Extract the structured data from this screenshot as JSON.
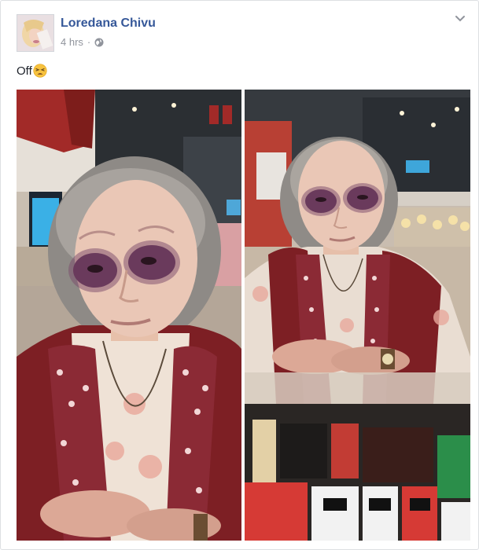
{
  "post": {
    "author": "Loredana Chivu",
    "timestamp": "4 hrs",
    "audience_icon": "globe-icon",
    "menu_icon": "chevron-down-icon",
    "caption": "Off",
    "caption_emoji": "tired-face-emoji"
  },
  "photos": [
    {
      "id": "left",
      "subject": "photo-elderly-woman-closeup"
    },
    {
      "id": "right",
      "subject": "photo-elderly-woman-at-kiosk"
    }
  ],
  "colors": {
    "author_link": "#365899",
    "meta_text": "#90949c",
    "caption_text": "#1d2129",
    "border": "#dddfe2"
  }
}
